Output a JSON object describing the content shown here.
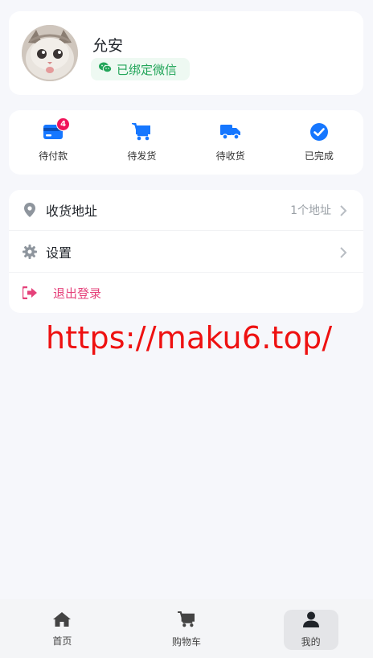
{
  "profile": {
    "name": "允安",
    "wechat_status": "已绑定微信"
  },
  "orders": [
    {
      "label": "待付款",
      "icon": "credit-card-icon",
      "badge": "4"
    },
    {
      "label": "待发货",
      "icon": "cart-icon"
    },
    {
      "label": "待收货",
      "icon": "truck-icon"
    },
    {
      "label": "已完成",
      "icon": "check-circle-icon"
    }
  ],
  "menu": {
    "address": {
      "label": "收货地址",
      "value": "1个地址",
      "icon": "location-pin-icon"
    },
    "settings": {
      "label": "设置",
      "icon": "gear-icon"
    },
    "logout": {
      "label": "退出登录",
      "icon": "logout-icon"
    }
  },
  "watermark": "https://maku6.top/",
  "tabs": [
    {
      "label": "首页",
      "icon": "home-icon"
    },
    {
      "label": "购物车",
      "icon": "cart-icon"
    },
    {
      "label": "我的",
      "icon": "user-icon",
      "active": true
    }
  ],
  "colors": {
    "accent_blue": "#1677ff",
    "wechat_green": "#22a559",
    "badge_red": "#f0145a",
    "logout_pink": "#e5417a",
    "watermark_red": "#ee1111"
  }
}
